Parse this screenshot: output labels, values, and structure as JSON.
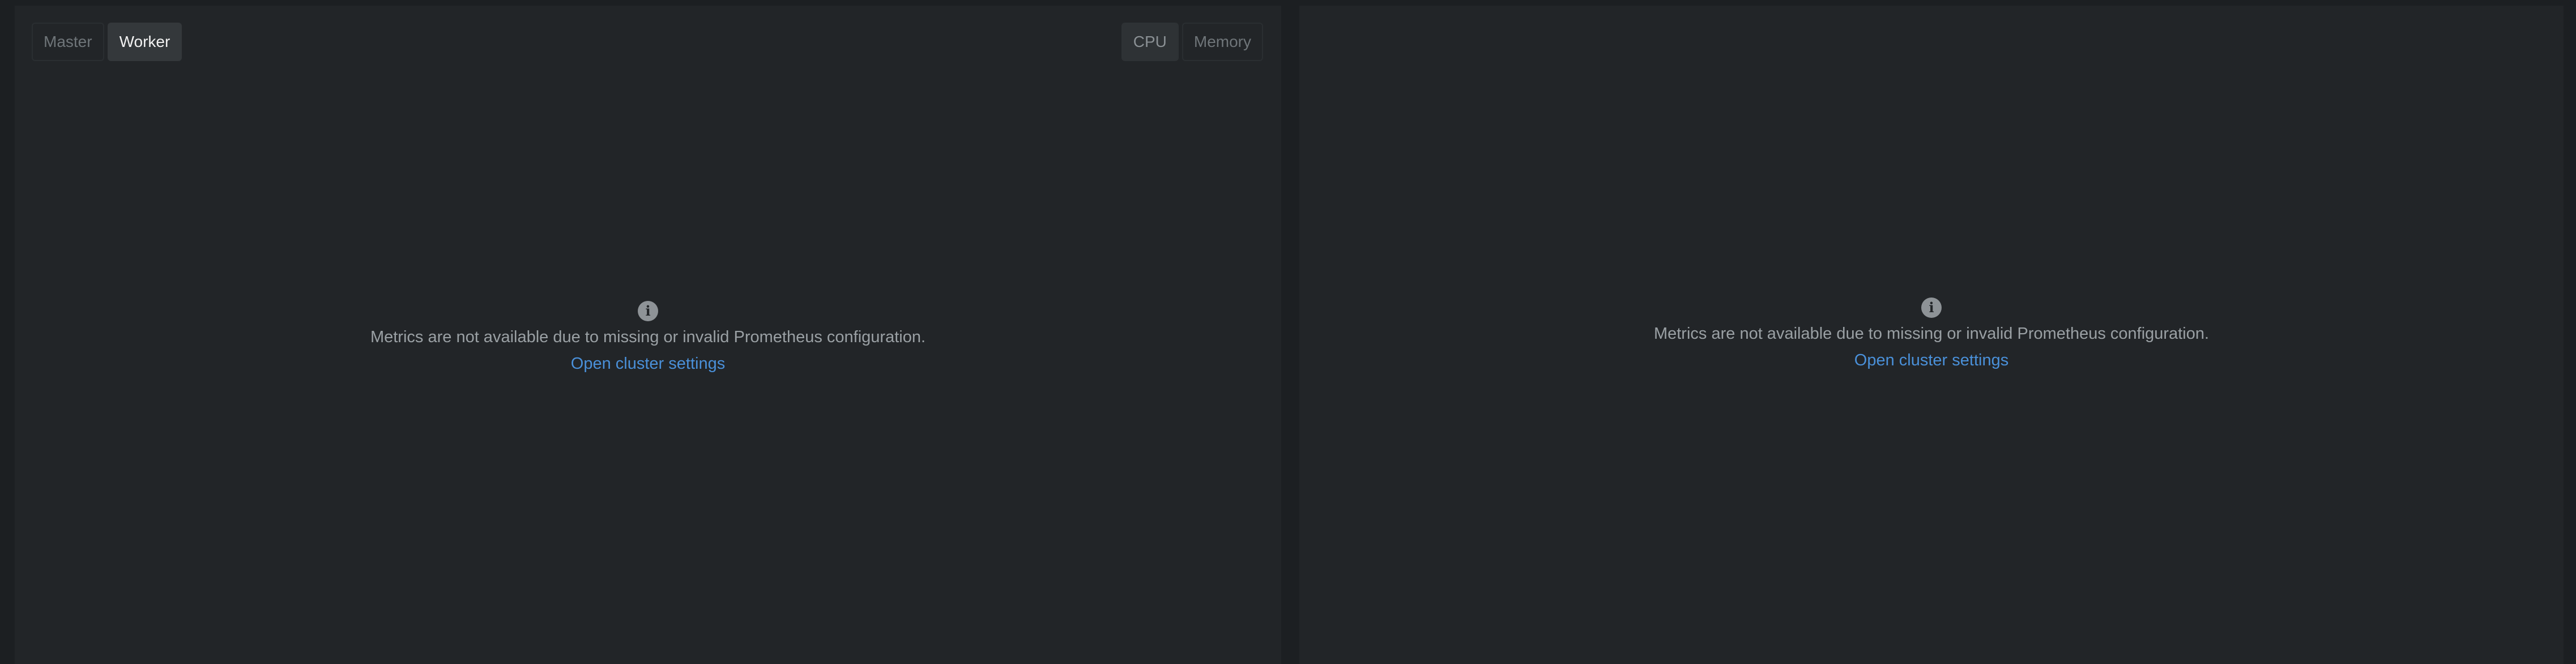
{
  "left_panel": {
    "node_tabs": [
      {
        "label": "Master",
        "active": false
      },
      {
        "label": "Worker",
        "active": true
      }
    ],
    "metric_tabs": [
      {
        "label": "CPU",
        "active": true
      },
      {
        "label": "Memory",
        "active": false
      }
    ],
    "empty_state": {
      "icon": "info-icon",
      "message": "Metrics are not available due to missing or invalid Prometheus configuration.",
      "link_label": "Open cluster settings"
    }
  },
  "right_panel": {
    "empty_state": {
      "icon": "info-icon",
      "message": "Metrics are not available due to missing or invalid Prometheus configuration.",
      "link_label": "Open cluster settings"
    }
  },
  "colors": {
    "background": "#1c1f22",
    "panel": "#222528",
    "link": "#4a90d9",
    "muted_text": "#9aa0a4"
  }
}
